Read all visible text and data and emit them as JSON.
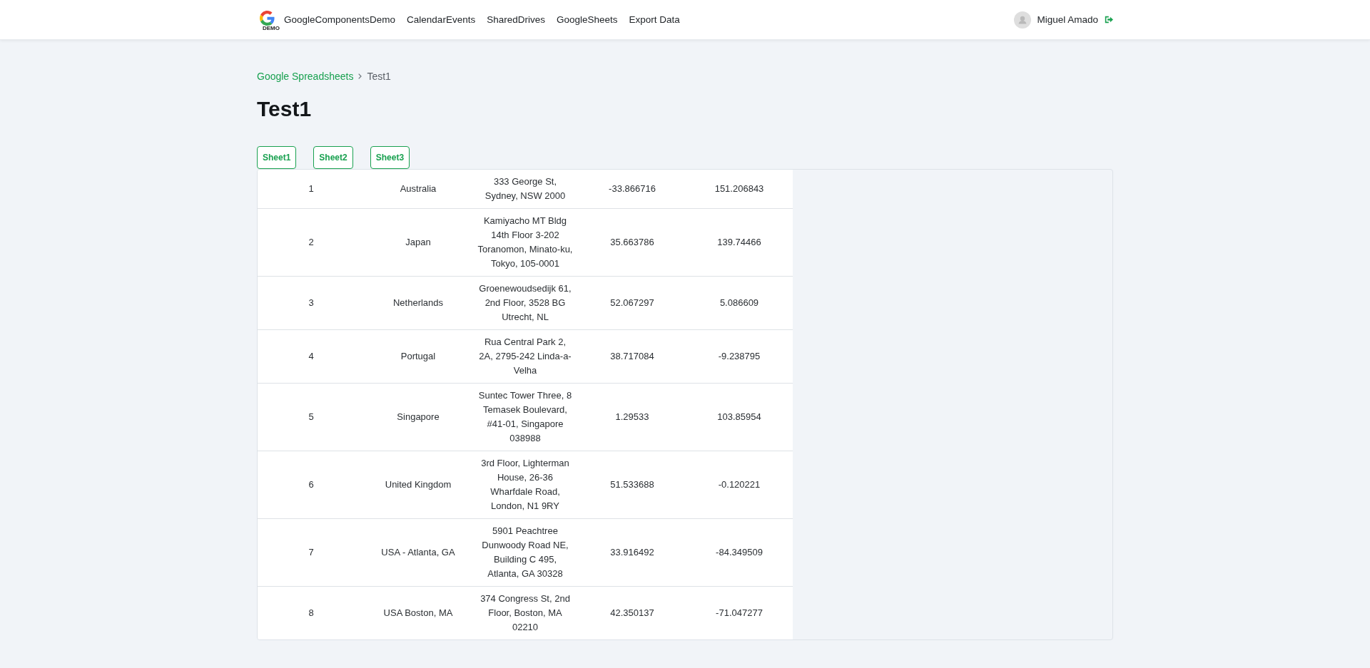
{
  "navbar": {
    "logo_badge": "DEMO",
    "brand": "GoogleComponentsDemo",
    "links": [
      "CalendarEvents",
      "SharedDrives",
      "GoogleSheets",
      "Export Data"
    ],
    "user": {
      "name": "Miguel Amado"
    }
  },
  "breadcrumb": {
    "items": [
      {
        "label": "Google Spreadsheets",
        "kind": "link"
      },
      {
        "label": "Test1",
        "kind": "current"
      }
    ]
  },
  "title": "Test1",
  "sheet_buttons": [
    "Sheet1",
    "Sheet2",
    "Sheet3"
  ],
  "table": {
    "rows": [
      [
        "1",
        "Australia",
        "333 George St, Sydney, NSW 2000",
        "-33.866716",
        "151.206843"
      ],
      [
        "2",
        "Japan",
        "Kamiyacho MT Bldg 14th Floor 3-202 Toranomon, Minato-ku, Tokyo, 105-0001",
        "35.663786",
        "139.74466"
      ],
      [
        "3",
        "Netherlands",
        "Groenewoudsedijk 61, 2nd Floor, 3528 BG Utrecht, NL",
        "52.067297",
        "5.086609"
      ],
      [
        "4",
        "Portugal",
        "Rua Central Park 2, 2A, 2795-242 Linda-a-Velha",
        "38.717084",
        "-9.238795"
      ],
      [
        "5",
        "Singapore",
        "Suntec Tower Three, 8 Temasek Boulevard, #41-01, Singapore 038988",
        "1.29533",
        "103.85954"
      ],
      [
        "6",
        "United Kingdom",
        "3rd Floor, Lighterman House, 26-36 Wharfdale Road, London, N1 9RY",
        "51.533688",
        "-0.120221"
      ],
      [
        "7",
        "USA - Atlanta, GA",
        "5901 Peachtree Dunwoody Road NE, Building C 495, Atlanta, GA 30328",
        "33.916492",
        "-84.349509"
      ],
      [
        "8",
        "USA Boston, MA",
        "374 Congress St, 2nd Floor, Boston, MA 02210",
        "42.350137",
        "-71.047277"
      ]
    ]
  }
}
